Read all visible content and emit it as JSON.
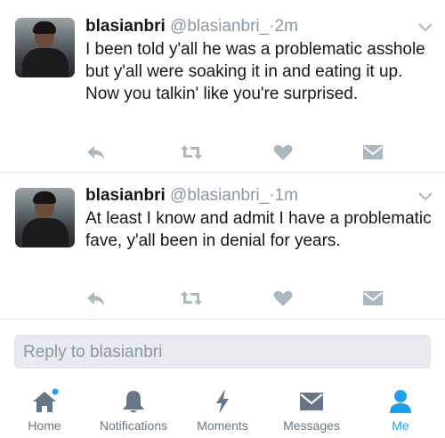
{
  "tweets": [
    {
      "name": "blasianbri",
      "handle": "@blasianbri_",
      "separator": "·",
      "time": "2m",
      "text": "I been told y'all he was a problematic asshole but y'all were soaking it in and eating it up. Now you talkin' like you're surprised."
    },
    {
      "name": "blasianbri",
      "handle": "@blasianbri_",
      "separator": "·",
      "time": "1m",
      "text": "At least I know and admit I have a problematic fave, y'all been in denial for years."
    }
  ],
  "action_icons": [
    "reply-icon",
    "retweet-icon",
    "like-icon",
    "direct-message-icon"
  ],
  "reply_bar": {
    "placeholder": "Reply to blasianbri"
  },
  "tabbar": {
    "tabs": [
      {
        "label": "Home",
        "icon": "home-icon",
        "has_notification_dot": true
      },
      {
        "label": "Notifications",
        "icon": "bell-icon"
      },
      {
        "label": "Moments",
        "icon": "lightning-icon"
      },
      {
        "label": "Messages",
        "icon": "envelope-icon"
      },
      {
        "label": "Me",
        "icon": "person-icon",
        "active": true
      }
    ]
  },
  "colors": {
    "accent": "#1da1f2",
    "muted": "#8899a6",
    "icon": "#aab8c2",
    "tab_icon": "#657786"
  }
}
